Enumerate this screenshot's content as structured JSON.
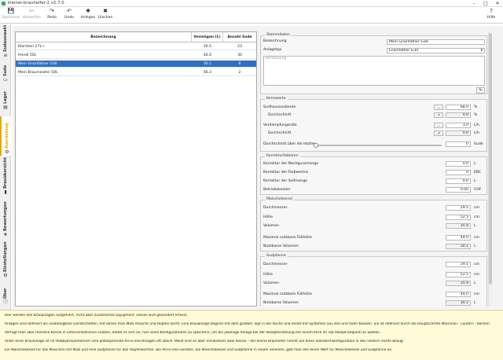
{
  "window": {
    "title": "kleiner-brauhelfer-2 v2.7.0",
    "minimize": "–",
    "maximize": "□",
    "close": "✕"
  },
  "toolbar": {
    "save": "Speichern",
    "discard": "Verwerfen",
    "redo": "Redo",
    "undo": "Undo",
    "add": "Anlegen",
    "delete": "Löschen",
    "help": "Hilfe"
  },
  "sidebar": [
    "Sudauswahl",
    "Sude",
    "Lager",
    "Ausrüstung",
    "Brauübersicht",
    "Bewertungen",
    "Einstellungen",
    "Über"
  ],
  "list": {
    "headers": [
      "Bezeichnung",
      "Vermögen (L)",
      "Anzahl Sude"
    ],
    "rows": [
      [
        "Klarstein 27L+",
        "26.5",
        "23"
      ],
      [
        "Hendi 50L",
        "44.0",
        "30"
      ],
      [
        "Mein Grainfather G30",
        "30.1",
        "8"
      ],
      [
        "Mein Braumeister 50L",
        "56.3",
        "2"
      ]
    ]
  },
  "stammdaten": {
    "title": "Stammdaten",
    "name_label": "Bezeichnung",
    "name_value": "Mein Grainfather G30",
    "type_label": "Anlagetyp",
    "type_value": "Grainfather G30",
    "notes_placeholder": "Bemerkung"
  },
  "kennwerte": {
    "title": "Kennwerte",
    "sha_label": "Sudhausausbeute",
    "sha_value": "68.0",
    "sha_unit": "%",
    "avg_label": "Durchschnitt",
    "avg1_value": "0.0",
    "avg1_unit": "%",
    "evap_label": "Verdampfungsrate",
    "evap_value": "3.0",
    "evap_unit": "L/h",
    "avg2_value": "0.0",
    "avg2_unit": "L/h",
    "last_label": "Durchschnitt über die letzten",
    "last_value": "0",
    "last_unit": "Sude"
  },
  "korrektur": {
    "title": "Korrekturfaktoren",
    "rows": [
      [
        "Korrektur der Nachgussmenge",
        "0.0",
        "L"
      ],
      [
        "Korrektur der Farbwertes",
        "0",
        "EBC"
      ],
      [
        "Korrektur der Sollmenge",
        "0.0",
        "L"
      ],
      [
        "Betriebskosten",
        "0.00",
        "CHF"
      ]
    ]
  },
  "maischekessel": {
    "title": "Maischekessel",
    "rows": [
      [
        "Durchmesser",
        "29.5",
        "cm"
      ],
      [
        "Höhe",
        "52.5",
        "cm"
      ],
      [
        "Volumen",
        "35.9",
        "L"
      ],
      [
        "Maximal nutzbare Füllhöhe",
        "44.0",
        "cm"
      ],
      [
        "Nutzbares Volumen",
        "30.1",
        "L"
      ]
    ]
  },
  "sudpfanne": {
    "title": "Sudpfanne",
    "rows": [
      [
        "Durchmesser",
        "29.5",
        "cm"
      ],
      [
        "Höhe",
        "52.5",
        "cm"
      ],
      [
        "Volumen",
        "35.9",
        "L"
      ],
      [
        "Maximal nutzbare Füllhöhe",
        "44.0",
        "cm"
      ],
      [
        "Nutzbares Volumen",
        "30.1",
        "L"
      ]
    ]
  },
  "info": [
    "Hier werden alle Brauanlagen aufgeführt, nicht aber zusätzliches Equipment. Dieses wird gesondert erfasst.",
    "Anlagen sind definiert als unabdingbare Gerätschaften, mit denen man Malz maischt und Hopfen kocht. Eine Brauanlage beginnt mit dem größten Topf in der Küche und endet mit Systemen aus drei und mehr Kesseln. Sie ist definiert durch die Hauptschritte Maischen - Läutern - Kochen.",
    "Verfügt man über mehrere Kessel in unterschiedlichen Größen, bietet es sich an, hier seine Konfigurationen zu speichern, um die jeweilige Anlage bei der Rezepterstellung mit einem Klick im Tab Rezept bequem zu wählen.",
    "Unter einer Brauanlage ist im Hobbybrauerbereich sind platzsparende All-in-one-Anlagen oft üblich. Meist sind es aber mindestens zwei Kessel – der kleine Brauhelfer nimmt auf diese Standard-Konfiguration in den Feldern rechts Bezug:",
    "Ein Maischekessel für das Maischen mit Malz und eine Sudpfanne für das Hopfenkochen. Bei All-in-one-Geräten, die Maischekessel und Sudpfanne in einem vereinen, gibt man den einen Wert für Maischekessel und Sudpfanne an."
  ]
}
